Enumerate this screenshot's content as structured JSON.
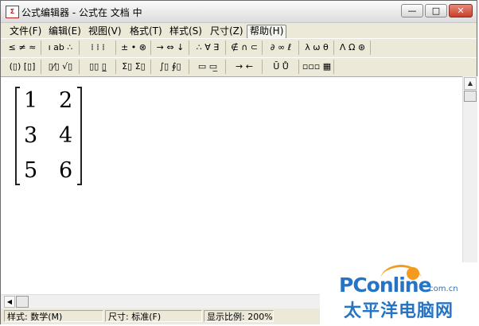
{
  "window": {
    "title": "公式编辑器 - 公式在 文档 中",
    "app_icon_text": "Σ"
  },
  "controls": {
    "minimize": "—",
    "maximize": "□",
    "close": "✕"
  },
  "menu": [
    {
      "label": "文件(F)"
    },
    {
      "label": "编辑(E)"
    },
    {
      "label": "视图(V)"
    },
    {
      "label": "格式(T)"
    },
    {
      "label": "样式(S)"
    },
    {
      "label": "尺寸(Z)"
    },
    {
      "label": "帮助(H)"
    }
  ],
  "toolbar_row1": [
    {
      "label": "≤ ≠ ≈"
    },
    {
      "label": "ı ab ∴"
    },
    {
      "label": "⁞ ⁞ ⁞"
    },
    {
      "label": "± • ⊗"
    },
    {
      "label": "→ ⇔ ↓"
    },
    {
      "label": "∴ ∀ ∃"
    },
    {
      "label": "∉ ∩ ⊂"
    },
    {
      "label": "∂ ∞ ℓ"
    },
    {
      "label": "λ ω θ"
    },
    {
      "label": "Λ Ω ⊛"
    }
  ],
  "toolbar_row2": [
    {
      "label": "(▯) [▯]"
    },
    {
      "label": "▯⁄▯ √▯"
    },
    {
      "label": "▯▯ ▯̲"
    },
    {
      "label": "Σ▯ Σ▯"
    },
    {
      "label": "∫▯ ∮▯"
    },
    {
      "label": "▭ ▭̲"
    },
    {
      "label": "→ ←"
    },
    {
      "label": "Ū Ů"
    },
    {
      "label": "▫▫▫ ▦"
    }
  ],
  "equation": {
    "matrix": [
      [
        "1",
        "2"
      ],
      [
        "3",
        "4"
      ],
      [
        "5",
        "6"
      ]
    ]
  },
  "scrollbar": {
    "up": "▲",
    "left": "◀"
  },
  "status": [
    {
      "label": "样式: 数学(M)"
    },
    {
      "label": "尺寸: 标准(F)"
    },
    {
      "label": "显示比例: 200%"
    }
  ],
  "watermark": {
    "brand": "PConline",
    "domain": ".com.cn",
    "cn_text": "太平洋电脑网"
  }
}
